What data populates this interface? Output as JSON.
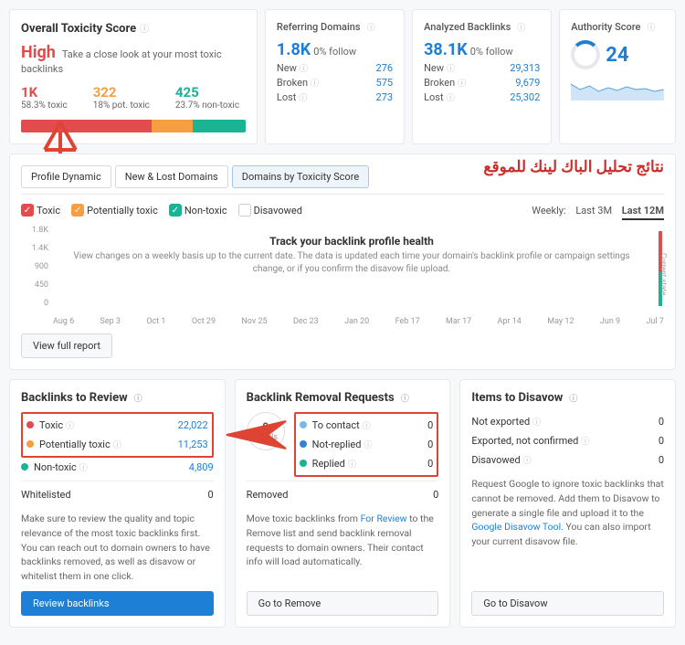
{
  "toxicity": {
    "title": "Overall Toxicity Score",
    "level": "High",
    "subtitle": "Take a close look at your most toxic backlinks",
    "m1_v": "1K",
    "m1_l": "58.3% toxic",
    "m2_v": "322",
    "m2_l": "18% pot. toxic",
    "m3_v": "425",
    "m3_l": "23.7% non-toxic"
  },
  "ref": {
    "title": "Referring Domains",
    "big": "1.8K",
    "big_sub": "0% follow",
    "r1l": "New",
    "r1v": "276",
    "r2l": "Broken",
    "r2v": "575",
    "r3l": "Lost",
    "r3v": "273"
  },
  "anal": {
    "title": "Analyzed Backlinks",
    "big": "38.1K",
    "big_sub": "0% follow",
    "r1l": "New",
    "r1v": "29,313",
    "r2l": "Broken",
    "r2v": "9,679",
    "r3l": "Lost",
    "r3v": "25,302"
  },
  "auth": {
    "title": "Authority Score",
    "value": "24"
  },
  "tabs": {
    "t1": "Profile Dynamic",
    "t2": "New & Lost Domains",
    "t3": "Domains by Toxicity Score",
    "arabic": "نتائج تحليل الباك لينك للموقع"
  },
  "legend": {
    "toxic": "Toxic",
    "pot": "Potentially toxic",
    "non": "Non-toxic",
    "dis": "Disavowed",
    "weekly": "Weekly:",
    "r3m": "Last 3M",
    "r12m": "Last 12M"
  },
  "chart": {
    "y": [
      "1.8K",
      "1.4K",
      "900",
      "450",
      "0"
    ],
    "title": "Track your backlink profile health",
    "msg": "View changes on a weekly basis up to the current date. The data is updated each time your domain's backlink profile or campaign settings change, or if you confirm the disavow file upload.",
    "x": [
      "Aug 6",
      "Sep 3",
      "Oct 1",
      "Oct 29",
      "Nov 25",
      "Dec 23",
      "Jan 20",
      "Feb 17",
      "Mar 17",
      "Apr 14",
      "May 12",
      "Jun 9",
      "Jul 7"
    ],
    "cs": "Current state"
  },
  "viewfull": "View full report",
  "review": {
    "title": "Backlinks to Review",
    "r1l": "Toxic",
    "r1v": "22,022",
    "r2l": "Potentially toxic",
    "r2v": "11,253",
    "r3l": "Non-toxic",
    "r3v": "4,809",
    "r4l": "Whitelisted",
    "r4v": "0",
    "desc": "Make sure to review the quality and topic relevance of the most toxic backlinks first. You can reach out to domain owners to have backlinks removed, as well as disavow or whitelist them in one click.",
    "btn": "Review backlinks"
  },
  "removal": {
    "title": "Backlink Removal Requests",
    "emails_n": "0",
    "emails_l": "emails",
    "r1l": "To contact",
    "r1v": "0",
    "r2l": "Not-replied",
    "r2v": "0",
    "r3l": "Replied",
    "r3v": "0",
    "r4l": "Removed",
    "r4v": "0",
    "desc_a": "Move toxic backlinks from ",
    "desc_link": "For Review",
    "desc_b": " to the Remove list and send backlink removal requests to domain owners. Their contact info will load automatically.",
    "btn": "Go to Remove"
  },
  "disavow": {
    "title": "Items to Disavow",
    "r1l": "Not exported",
    "r1v": "0",
    "r2l": "Exported, not confirmed",
    "r2v": "0",
    "r3l": "Disavowed",
    "r3v": "0",
    "desc_a": "Request Google to ignore toxic backlinks that cannot be removed. Add them to Disavow to generate a single file and upload it to the ",
    "desc_link": "Google Disavow Tool",
    "desc_b": ". You can also import your current disavow file.",
    "btn": "Go to Disavow"
  },
  "chart_data": {
    "type": "bar",
    "note": "Chart shows empty state / placeholder message; no plotted series visible except current-state indicator on far right.",
    "x_categories": [
      "Aug 6",
      "Sep 3",
      "Oct 1",
      "Oct 29",
      "Nov 25",
      "Dec 23",
      "Jan 20",
      "Feb 17",
      "Mar 17",
      "Apr 14",
      "May 12",
      "Jun 9",
      "Jul 7"
    ],
    "y_ticks": [
      0,
      450,
      900,
      1400,
      1800
    ],
    "ylim": [
      0,
      1800
    ],
    "series": [],
    "title": "Track your backlink profile health"
  }
}
